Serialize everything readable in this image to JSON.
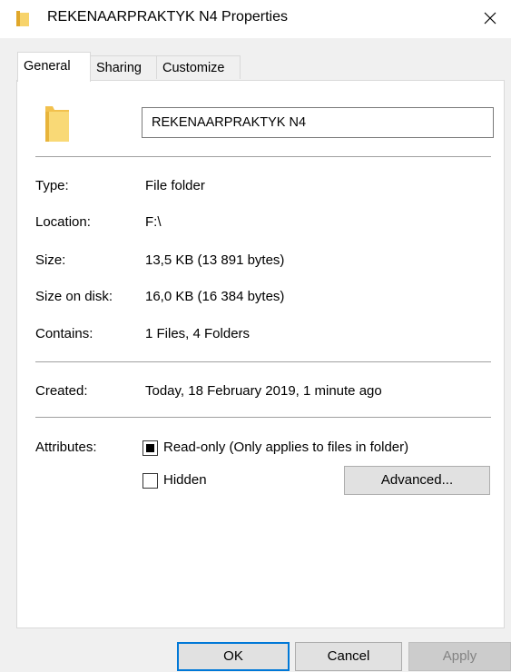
{
  "window": {
    "title": "REKENAARPRAKTYK N4 Properties",
    "close_label": "×"
  },
  "tabs": [
    {
      "label": "General",
      "active": true
    },
    {
      "label": "Sharing",
      "active": false
    },
    {
      "label": "Customize",
      "active": false
    }
  ],
  "general": {
    "folder_name": "REKENAARPRAKTYK N4",
    "type_label": "Type:",
    "type_value": "File folder",
    "location_label": "Location:",
    "location_value": "F:\\",
    "size_label": "Size:",
    "size_value": "13,5 KB (13 891 bytes)",
    "size_on_disk_label": "Size on disk:",
    "size_on_disk_value": "16,0 KB (16 384 bytes)",
    "contains_label": "Contains:",
    "contains_value": "1 Files, 4 Folders",
    "created_label": "Created:",
    "created_value": "Today, 18 February 2019, 1 minute ago",
    "attributes_label": "Attributes:",
    "readonly_label": "Read-only (Only applies to files in folder)",
    "readonly_state": "indeterminate",
    "hidden_label": "Hidden",
    "hidden_checked": false,
    "advanced_label": "Advanced..."
  },
  "buttons": {
    "ok": "OK",
    "cancel": "Cancel",
    "apply": "Apply"
  },
  "colors": {
    "folder": "#f7d36b",
    "focus_border": "#0078d7"
  },
  "icons": {
    "title_icon": "folder-icon",
    "big_icon": "folder-icon",
    "close_icon": "close-icon"
  }
}
